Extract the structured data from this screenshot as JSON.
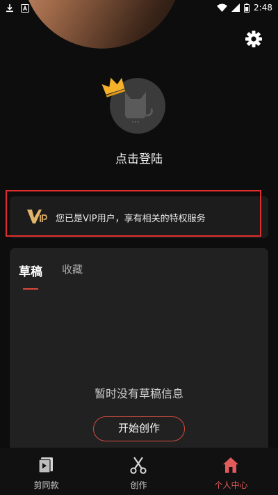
{
  "status_bar": {
    "time": "2:48"
  },
  "profile": {
    "login_label": "点击登陆"
  },
  "vip": {
    "logo_text": "VIP",
    "message": "您已是VIP用户，享有相关的特权服务"
  },
  "drafts": {
    "tabs": [
      {
        "label": "草稿"
      },
      {
        "label": "收藏"
      }
    ],
    "empty_message": "暂时没有草稿信息",
    "start_button_label": "开始创作"
  },
  "bottom_nav": {
    "items": [
      {
        "label": "剪同款",
        "icon": "template-icon"
      },
      {
        "label": "创作",
        "icon": "scissors-icon"
      },
      {
        "label": "个人中心",
        "icon": "home-icon"
      }
    ],
    "active_index": 2
  },
  "colors": {
    "accent": "#e0473a",
    "highlight_border": "#e02e2e",
    "background": "#0d0d0d"
  }
}
